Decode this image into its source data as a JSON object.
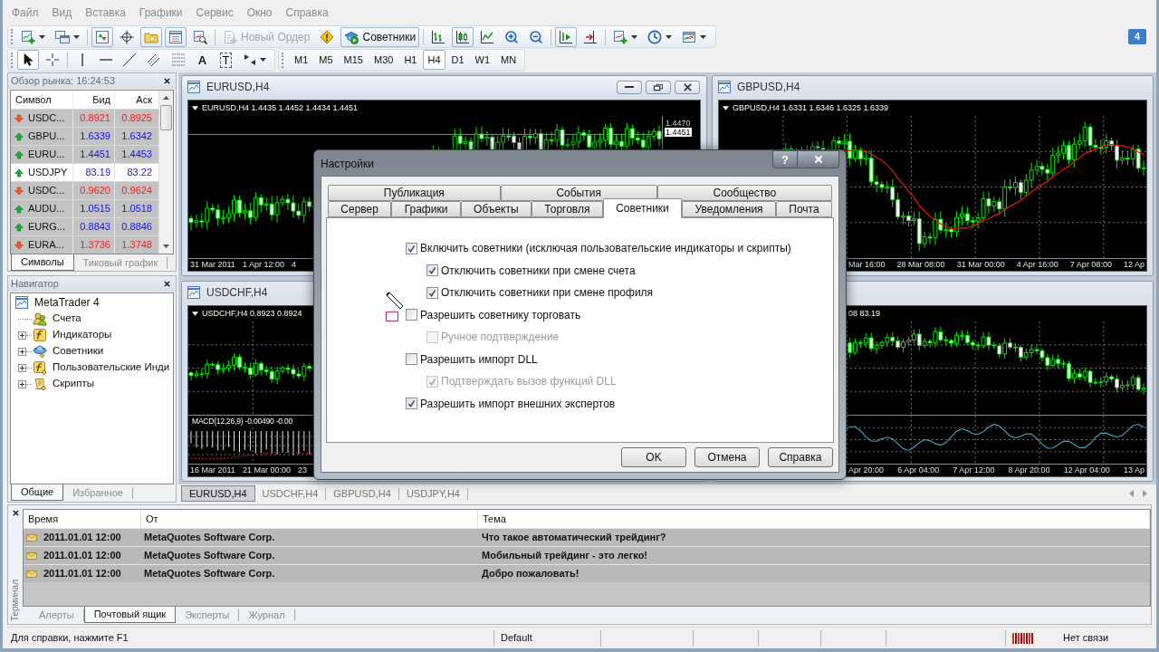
{
  "menu": [
    "Файл",
    "Вид",
    "Вставка",
    "Графики",
    "Сервис",
    "Окно",
    "Справка"
  ],
  "toolbar": {
    "groups": [
      [
        {
          "kind": "new_chart",
          "pressed": false,
          "disabled": false
        },
        {
          "kind": "profiles",
          "pressed": false,
          "disabled": false
        }
      ],
      [
        {
          "kind": "market_watch",
          "pressed": true,
          "disabled": false
        },
        {
          "kind": "data_window",
          "pressed": false,
          "disabled": false
        },
        {
          "kind": "navigator",
          "pressed": true,
          "disabled": false
        },
        {
          "kind": "terminal",
          "pressed": true,
          "disabled": false
        },
        {
          "kind": "tester",
          "pressed": false,
          "disabled": false
        }
      ],
      [
        {
          "kind": "new_order",
          "label": "Новый Ордер",
          "pressed": false,
          "disabled": true
        },
        {
          "kind": "metaeditor",
          "pressed": false,
          "disabled": false
        },
        {
          "kind": "autotrading",
          "label": "Советники",
          "pressed": true,
          "disabled": false
        }
      ],
      [
        {
          "kind": "bar_chart",
          "pressed": false,
          "disabled": false
        },
        {
          "kind": "candlesticks",
          "pressed": true,
          "disabled": false
        },
        {
          "kind": "line_chart",
          "pressed": false,
          "disabled": false
        },
        {
          "kind": "zoom_in",
          "pressed": false,
          "disabled": false
        },
        {
          "kind": "zoom_out",
          "pressed": false,
          "disabled": false
        }
      ],
      [
        {
          "kind": "autoscroll",
          "pressed": true,
          "disabled": false
        },
        {
          "kind": "chart_shift",
          "pressed": false,
          "disabled": false
        }
      ],
      [
        {
          "kind": "indicators",
          "pressed": false,
          "disabled": false
        },
        {
          "kind": "periods",
          "pressed": false,
          "disabled": false
        },
        {
          "kind": "templates",
          "pressed": false,
          "disabled": false
        }
      ]
    ],
    "badge": "4"
  },
  "drawing_tools": [
    [
      {
        "kind": "cursor",
        "selected": true
      },
      {
        "kind": "crosshair",
        "selected": false
      }
    ],
    [
      {
        "kind": "vertical_line",
        "selected": false
      },
      {
        "kind": "horizontal_line",
        "selected": false
      },
      {
        "kind": "trend_line",
        "selected": false
      },
      {
        "kind": "channel",
        "selected": false
      },
      {
        "kind": "fibonacci",
        "selected": false
      },
      {
        "kind": "text",
        "label": "A",
        "selected": false
      },
      {
        "kind": "text_label",
        "label": "T",
        "selected": false
      },
      {
        "kind": "arrows",
        "selected": false
      }
    ]
  ],
  "timeframes": [
    {
      "label": "M1",
      "selected": false
    },
    {
      "label": "M5",
      "selected": false
    },
    {
      "label": "M15",
      "selected": false
    },
    {
      "label": "M30",
      "selected": false
    },
    {
      "label": "H1",
      "selected": false
    },
    {
      "label": "H4",
      "selected": true
    },
    {
      "label": "D1",
      "selected": false
    },
    {
      "label": "W1",
      "selected": false
    },
    {
      "label": "MN",
      "selected": false
    }
  ],
  "market_watch": {
    "title": "Обзор рынка: 16:24:53",
    "columns": [
      "Символ",
      "Бид",
      "Аск"
    ],
    "rows": [
      {
        "symbol": "USDC...",
        "bid": "0.8921",
        "ask": "0.8925",
        "kind": "down",
        "selected": false
      },
      {
        "symbol": "GBPU...",
        "bid": "1.6339",
        "ask": "1.6342",
        "kind": "up",
        "selected": false
      },
      {
        "symbol": "EURU...",
        "bid": "1.4451",
        "ask": "1.4453",
        "kind": "up",
        "selected": false
      },
      {
        "symbol": "USDJPY",
        "bid": "83.19",
        "ask": "83.22",
        "kind": "up",
        "selected": true
      },
      {
        "symbol": "USDC...",
        "bid": "0.9620",
        "ask": "0.9624",
        "kind": "down",
        "selected": false
      },
      {
        "symbol": "AUDU...",
        "bid": "1.0515",
        "ask": "1.0518",
        "kind": "up",
        "selected": false
      },
      {
        "symbol": "EURG...",
        "bid": "0.8843",
        "ask": "0.8846",
        "kind": "up",
        "selected": false
      },
      {
        "symbol": "EURA...",
        "bid": "1.3736",
        "ask": "1.3748",
        "kind": "down",
        "selected": false
      }
    ],
    "tabs": [
      {
        "label": "Символы",
        "selected": true
      },
      {
        "label": "Тиковый график",
        "selected": false
      }
    ]
  },
  "navigator": {
    "title": "Навигатор",
    "tree": [
      {
        "label": "MetaTrader 4",
        "kind": "terminal",
        "children": [
          {
            "label": "Счета",
            "kind": "accounts"
          },
          {
            "label": "Индикаторы",
            "kind": "indicators",
            "expanded": false
          },
          {
            "label": "Советники",
            "kind": "experts",
            "expanded": false
          },
          {
            "label": "Пользовательские Инди",
            "kind": "custom_indicators",
            "expanded": false
          },
          {
            "label": "Скрипты",
            "kind": "scripts",
            "expanded": false
          }
        ]
      }
    ],
    "tabs": [
      {
        "label": "Общие",
        "selected": true
      },
      {
        "label": "Избранное",
        "selected": false
      }
    ]
  },
  "charts": [
    {
      "title": "EURUSD,H4",
      "active": true,
      "kind": "plain",
      "info": "EURUSD,H4 1.4435 1.4452 1.4434 1.4451",
      "price_labels": [
        "1.4470",
        "1.4451"
      ],
      "time_labels": [
        "31 Mar 2011",
        "1 Apr 12:00",
        "4"
      ]
    },
    {
      "title": "GBPUSD,H4",
      "active": false,
      "kind": "moving_average",
      "info": "GBPUSD,H4 1.6331 1.6346 1.6325 1.6339",
      "time_labels": [
        "Mar 16:00",
        "28 Mar 08:00",
        "31 Mar 00:00",
        "4 Apr 16:00",
        "7 Apr 08:00",
        "12 Ap"
      ]
    },
    {
      "title": "USDCHF,H4",
      "active": false,
      "kind": "macd",
      "info": "USDCHF,H4 0.8923 0.8924",
      "indicator_label": "MACD(12,26,9) -0.00490 -0.00",
      "time_labels": [
        "16 Mar 2011",
        "21 Mar 00:00",
        "23"
      ]
    },
    {
      "active": false,
      "kind": "oscillator",
      "info": "08 83.19",
      "time_labels": [
        "Apr 20:00",
        "6 Apr 04:00",
        "7 Apr 12:00",
        "8 Apr 20:00",
        "12 Apr 04:00",
        "13 Ap"
      ]
    }
  ],
  "chart_tabs": [
    {
      "label": "EURUSD,H4",
      "selected": true
    },
    {
      "label": "USDCHF,H4",
      "selected": false
    },
    {
      "label": "GBPUSD,H4",
      "selected": false
    },
    {
      "label": "USDJPY,H4",
      "selected": false
    }
  ],
  "terminal": {
    "title": "Терминал",
    "columns": [
      "Время",
      "От",
      "Тема"
    ],
    "rows": [
      {
        "time": "2011.01.01 12:00",
        "from": "MetaQuotes Software Corp.",
        "subject": "Что такое автоматический трейдинг?",
        "unread": true
      },
      {
        "time": "2011.01.01 12:00",
        "from": "MetaQuotes Software Corp.",
        "subject": "Мобильный трейдинг - это легко!",
        "unread": true
      },
      {
        "time": "2011.01.01 12:00",
        "from": "MetaQuotes Software Corp.",
        "subject": "Добро пожаловать!",
        "unread": true
      }
    ],
    "tabs": [
      {
        "label": "Алерты",
        "selected": false
      },
      {
        "label": "Почтовый ящик",
        "selected": true
      },
      {
        "label": "Эксперты",
        "selected": false
      },
      {
        "label": "Журнал",
        "selected": false
      }
    ]
  },
  "status_bar": {
    "help": "Для справки, нажмите F1",
    "profile": "Default",
    "connection": "Нет связи"
  },
  "dialog": {
    "title": "Настройки",
    "help_button": "?",
    "tab_rows": [
      [
        {
          "label": "Публикация",
          "selected": false
        },
        {
          "label": "События",
          "selected": false
        },
        {
          "label": "Сообщество",
          "selected": false
        }
      ],
      [
        {
          "label": "Сервер",
          "selected": false
        },
        {
          "label": "Графики",
          "selected": false
        },
        {
          "label": "Объекты",
          "selected": false
        },
        {
          "label": "Торговля",
          "selected": false
        },
        {
          "label": "Советники",
          "selected": true
        },
        {
          "label": "Уведомления",
          "selected": false
        },
        {
          "label": "Почта",
          "selected": false
        }
      ]
    ],
    "options": [
      {
        "label": "Включить советники (исключая пользовательские индикаторы и скрипты)",
        "checked": true,
        "disabled": false,
        "children": [
          {
            "label": "Отключить советники при смене счета",
            "checked": true,
            "disabled": false
          },
          {
            "label": "Отключить советники при смене профиля",
            "checked": true,
            "disabled": false
          }
        ]
      },
      {
        "label": "Разрешить советнику торговать",
        "checked": false,
        "disabled": false,
        "children": [
          {
            "label": "Ручное подтверждение",
            "checked": false,
            "disabled": true
          }
        ]
      },
      {
        "label": "Разрешить импорт DLL",
        "checked": false,
        "disabled": false,
        "children": [
          {
            "label": "Подтверждать вызов функций DLL",
            "checked": true,
            "disabled": true
          }
        ]
      },
      {
        "label": "Разрешить импорт внешних экспертов",
        "checked": true,
        "disabled": false
      }
    ],
    "buttons": [
      "OK",
      "Отмена",
      "Справка"
    ]
  }
}
